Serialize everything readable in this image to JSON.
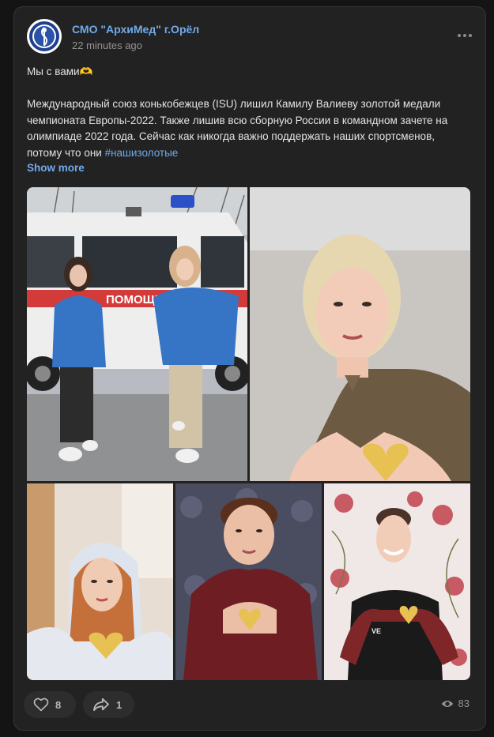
{
  "post": {
    "author": "СМО \"АрхиМед\" г.Орёл",
    "time": "22 minutes ago",
    "line1": "Мы с вами🫶",
    "body": "Международный союз конькобежцев (ISU) лишил Камилу Валиеву золотой медали чемпионата Европы-2022. Также лишив всю сборную России в командном зачете на олимпиаде 2022 года. Сейчас как никогда важно поддержать наших спортсменов, потому что они ",
    "hashtag": "#нашизолотые",
    "show_more": "Show more",
    "ambulance_sign": "ПОМОЩЬ",
    "shirt_text": "VE"
  },
  "actions": {
    "likes": "8",
    "shares": "1",
    "views": "83"
  },
  "icons": {
    "avatar": "group-logo",
    "more": "more-horizontal-icon",
    "like": "heart-icon",
    "share": "share-arrow-icon",
    "views": "eye-icon"
  },
  "colors": {
    "link": "#71aaeb",
    "card": "#222222",
    "background": "#141414"
  }
}
